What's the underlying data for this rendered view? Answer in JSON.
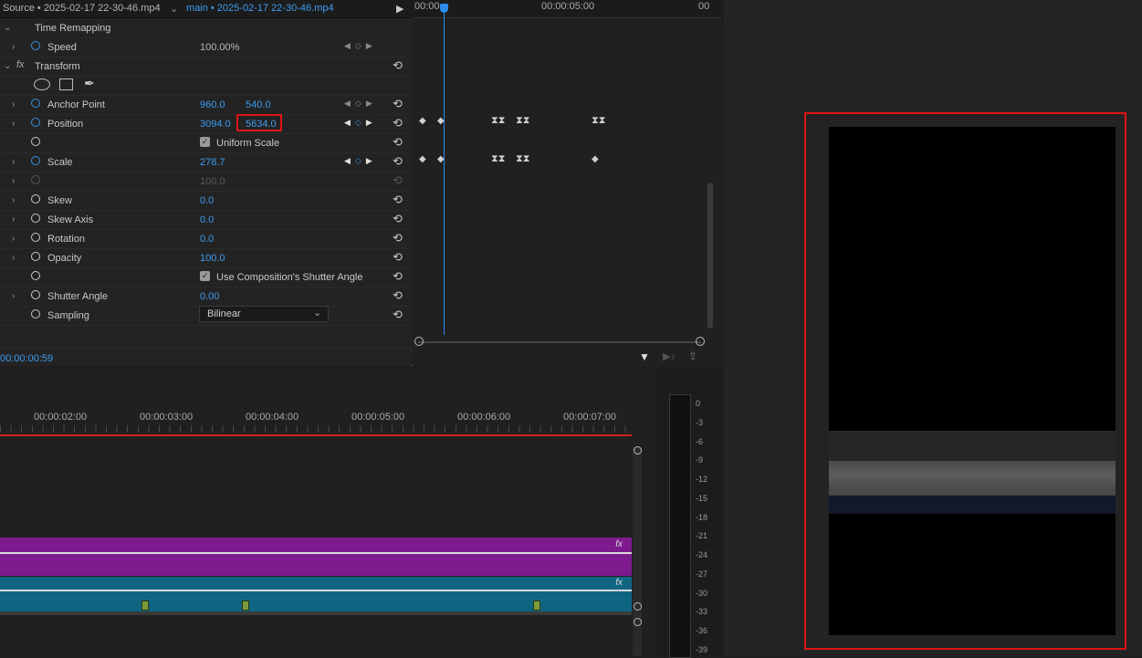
{
  "effect_controls": {
    "source_tab": "Source • 2025-02-17 22-30-46.mp4",
    "sequence_tab": "main • 2025-02-17 22-30-46.mp4",
    "timecode": "00:00:00:59",
    "time_remapping": "Time Remapping",
    "speed": {
      "label": "Speed",
      "value": "100.00%"
    },
    "transform": {
      "label": "Transform",
      "fx": "fx"
    },
    "anchor_point": {
      "label": "Anchor Point",
      "x": "960.0",
      "y": "540.0"
    },
    "position": {
      "label": "Position",
      "x": "3094.0",
      "y": "5634.0"
    },
    "uniform_scale": "Uniform Scale",
    "scale": {
      "label": "Scale",
      "value": "278.7"
    },
    "scale_width": {
      "value": "100.0"
    },
    "skew": {
      "label": "Skew",
      "value": "0.0"
    },
    "skew_axis": {
      "label": "Skew Axis",
      "value": "0.0"
    },
    "rotation": {
      "label": "Rotation",
      "value": "0.0"
    },
    "opacity": {
      "label": "Opacity",
      "value": "100.0"
    },
    "use_comp_shutter": "Use Composition's Shutter Angle",
    "shutter_angle": {
      "label": "Shutter Angle",
      "value": "0.00"
    },
    "sampling": {
      "label": "Sampling",
      "value": "Bilinear"
    },
    "ruler": [
      "00:00",
      "00:00:05:00",
      "00"
    ]
  },
  "timeline": {
    "ruler": [
      "00:00:02:00",
      "00:00:03:00",
      "00:00:04:00",
      "00:00:05:00",
      "00:00:06:00",
      "00:00:07:00"
    ],
    "fx_badge": "fx"
  },
  "audio_meter": {
    "db_labels": [
      "0",
      "-3",
      "-6",
      "-9",
      "-12",
      "-15",
      "-18",
      "-21",
      "-24",
      "-27",
      "-30",
      "-33",
      "-36",
      "-39"
    ]
  },
  "colors": {
    "accent": "#2d8ceb",
    "highlight": "#e01515",
    "video_clip": "#7c1a8e",
    "audio_clip": "#0f6482"
  }
}
